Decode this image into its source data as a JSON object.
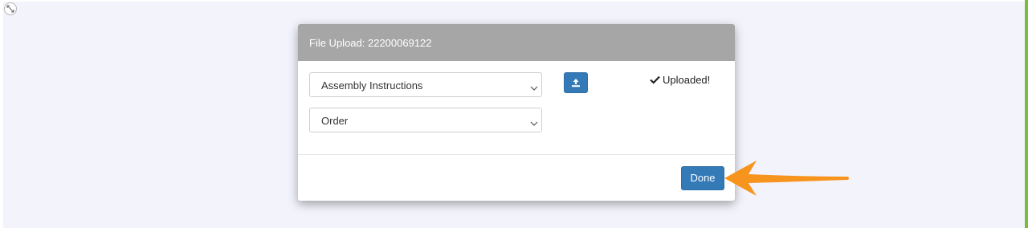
{
  "modal": {
    "title": "File Upload: 22200069122",
    "document_type_select": {
      "value": "Assembly Instructions"
    },
    "category_select": {
      "value": "Order"
    },
    "upload_button_icon": "upload-icon",
    "status_text": "Uploaded!",
    "status_icon": "checkmark-icon",
    "done_label": "Done"
  },
  "annotation": {
    "arrow_icon": "arrow-left-icon",
    "arrow_color": "#f7941d"
  },
  "colors": {
    "header_bg": "#a6a6a6",
    "primary_button": "#337ab7",
    "canvas_bg": "#f2f3fb",
    "right_edge_accent": "#7dbb3c"
  }
}
